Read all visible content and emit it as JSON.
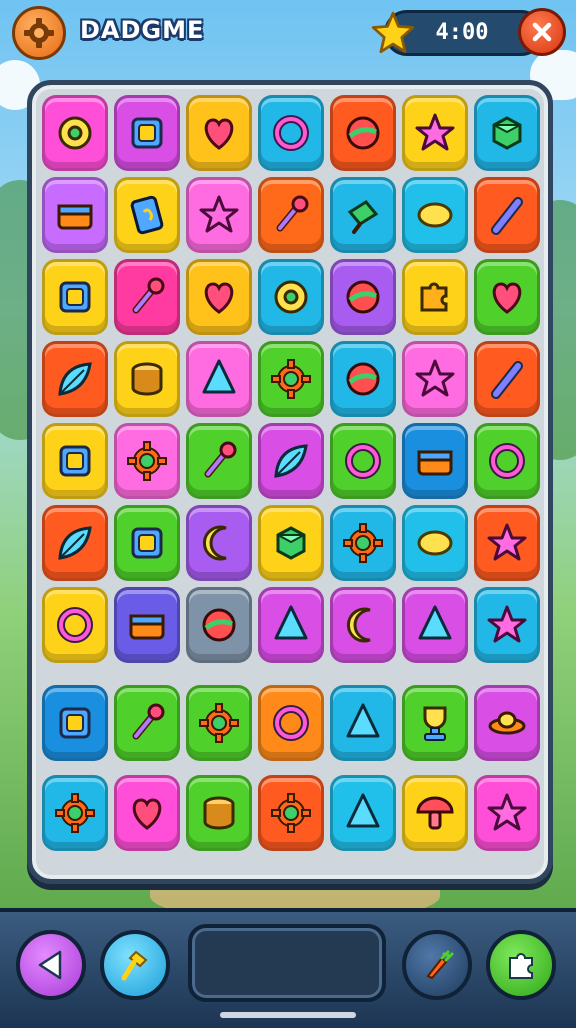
{
  "header": {
    "title": "DADGME",
    "timer": "4:00",
    "icons": {
      "settings": "gear-icon",
      "star": "star-icon",
      "close": "close-icon"
    },
    "colors": {
      "settings": "#e86a12",
      "close": "#d8360f",
      "timer_bg": "#244a6e"
    }
  },
  "board": {
    "rows": 9,
    "cols": 7,
    "tiles": [
      [
        {
          "color": "#ff4fd8",
          "item": "donut"
        },
        {
          "color": "#d94fe6",
          "item": "box"
        },
        {
          "color": "#ffc21a",
          "item": "heart"
        },
        {
          "color": "#21b8e8",
          "item": "ring"
        },
        {
          "color": "#ff5a1f",
          "item": "ball"
        },
        {
          "color": "#ffd21a",
          "item": "star"
        },
        {
          "color": "#21b8e8",
          "item": "cube"
        }
      ],
      [
        {
          "color": "#c86bff",
          "item": "chest"
        },
        {
          "color": "#ffd21a",
          "item": "card"
        },
        {
          "color": "#ff6be0",
          "item": "star"
        },
        {
          "color": "#ff6a1a",
          "item": "wand"
        },
        {
          "color": "#21b8e8",
          "item": "shovel"
        },
        {
          "color": "#21c0ea",
          "item": "lemon"
        },
        {
          "color": "#ff5a1f",
          "item": "pen"
        }
      ],
      [
        {
          "color": "#ffd21a",
          "item": "box"
        },
        {
          "color": "#ff3aa0",
          "item": "wand"
        },
        {
          "color": "#ffc21a",
          "item": "heart"
        },
        {
          "color": "#21b8e8",
          "item": "donut"
        },
        {
          "color": "#a85cf0",
          "item": "ball"
        },
        {
          "color": "#ffd21a",
          "item": "puzzle"
        },
        {
          "color": "#4fd02a",
          "item": "heart"
        }
      ],
      [
        {
          "color": "#ff5a1f",
          "item": "leaf"
        },
        {
          "color": "#ffd21a",
          "item": "drum"
        },
        {
          "color": "#ff6be0",
          "item": "cone"
        },
        {
          "color": "#4fd02a",
          "item": "gear"
        },
        {
          "color": "#21b8e8",
          "item": "ball"
        },
        {
          "color": "#ff6be0",
          "item": "star"
        },
        {
          "color": "#ff5a1f",
          "item": "pen"
        }
      ],
      [
        {
          "color": "#ffd21a",
          "item": "box"
        },
        {
          "color": "#ff6be0",
          "item": "gear"
        },
        {
          "color": "#4fd02a",
          "item": "wand"
        },
        {
          "color": "#d94fe6",
          "item": "leaf"
        },
        {
          "color": "#4fd02a",
          "item": "ring"
        },
        {
          "color": "#1a8fe0",
          "item": "chest"
        },
        {
          "color": "#4fd02a",
          "item": "ring"
        }
      ],
      [
        {
          "color": "#ff5a1f",
          "item": "leaf"
        },
        {
          "color": "#4fd02a",
          "item": "box"
        },
        {
          "color": "#a85cf0",
          "item": "moon"
        },
        {
          "color": "#ffd21a",
          "item": "cube"
        },
        {
          "color": "#21b8e8",
          "item": "gear"
        },
        {
          "color": "#21c0ea",
          "item": "lemon"
        },
        {
          "color": "#ff5a1f",
          "item": "star"
        }
      ],
      [
        {
          "color": "#ffd21a",
          "item": "ring"
        },
        {
          "color": "#6a5ce6",
          "item": "chest"
        },
        {
          "color": "#7f93a8",
          "item": "ball"
        },
        {
          "color": "#d94fe6",
          "item": "cone"
        },
        {
          "color": "#d94fe6",
          "item": "moon"
        },
        {
          "color": "#d94fe6",
          "item": "cone"
        },
        {
          "color": "#21b8e8",
          "item": "star"
        }
      ],
      [
        {
          "color": "#1a8fe0",
          "item": "box"
        },
        {
          "color": "#4fd02a",
          "item": "wand"
        },
        {
          "color": "#4fd02a",
          "item": "gear"
        },
        {
          "color": "#ff8a1a",
          "item": "ring"
        },
        {
          "color": "#21b8e8",
          "item": "cone"
        },
        {
          "color": "#4fd02a",
          "item": "trophy"
        },
        {
          "color": "#d94fe6",
          "item": "ufo"
        }
      ],
      [
        {
          "color": "#21b8e8",
          "item": "gear"
        },
        {
          "color": "#ff4fd8",
          "item": "heart"
        },
        {
          "color": "#4fd02a",
          "item": "drum"
        },
        {
          "color": "#ff5a1f",
          "item": "gear"
        },
        {
          "color": "#21c0ea",
          "item": "cone"
        },
        {
          "color": "#ffd21a",
          "item": "mushroom"
        },
        {
          "color": "#ff4fd8",
          "item": "star"
        }
      ]
    ]
  },
  "footer": {
    "icons": {
      "back": "back-arrow-icon",
      "hint": "hammer-icon",
      "booster": "rocket-icon",
      "shuffle": "puzzle-icon"
    },
    "colors": {
      "back": "#c24fe6",
      "hint": "#21b8e8",
      "booster": "#2b4f78",
      "shuffle": "#4fc82a"
    }
  }
}
